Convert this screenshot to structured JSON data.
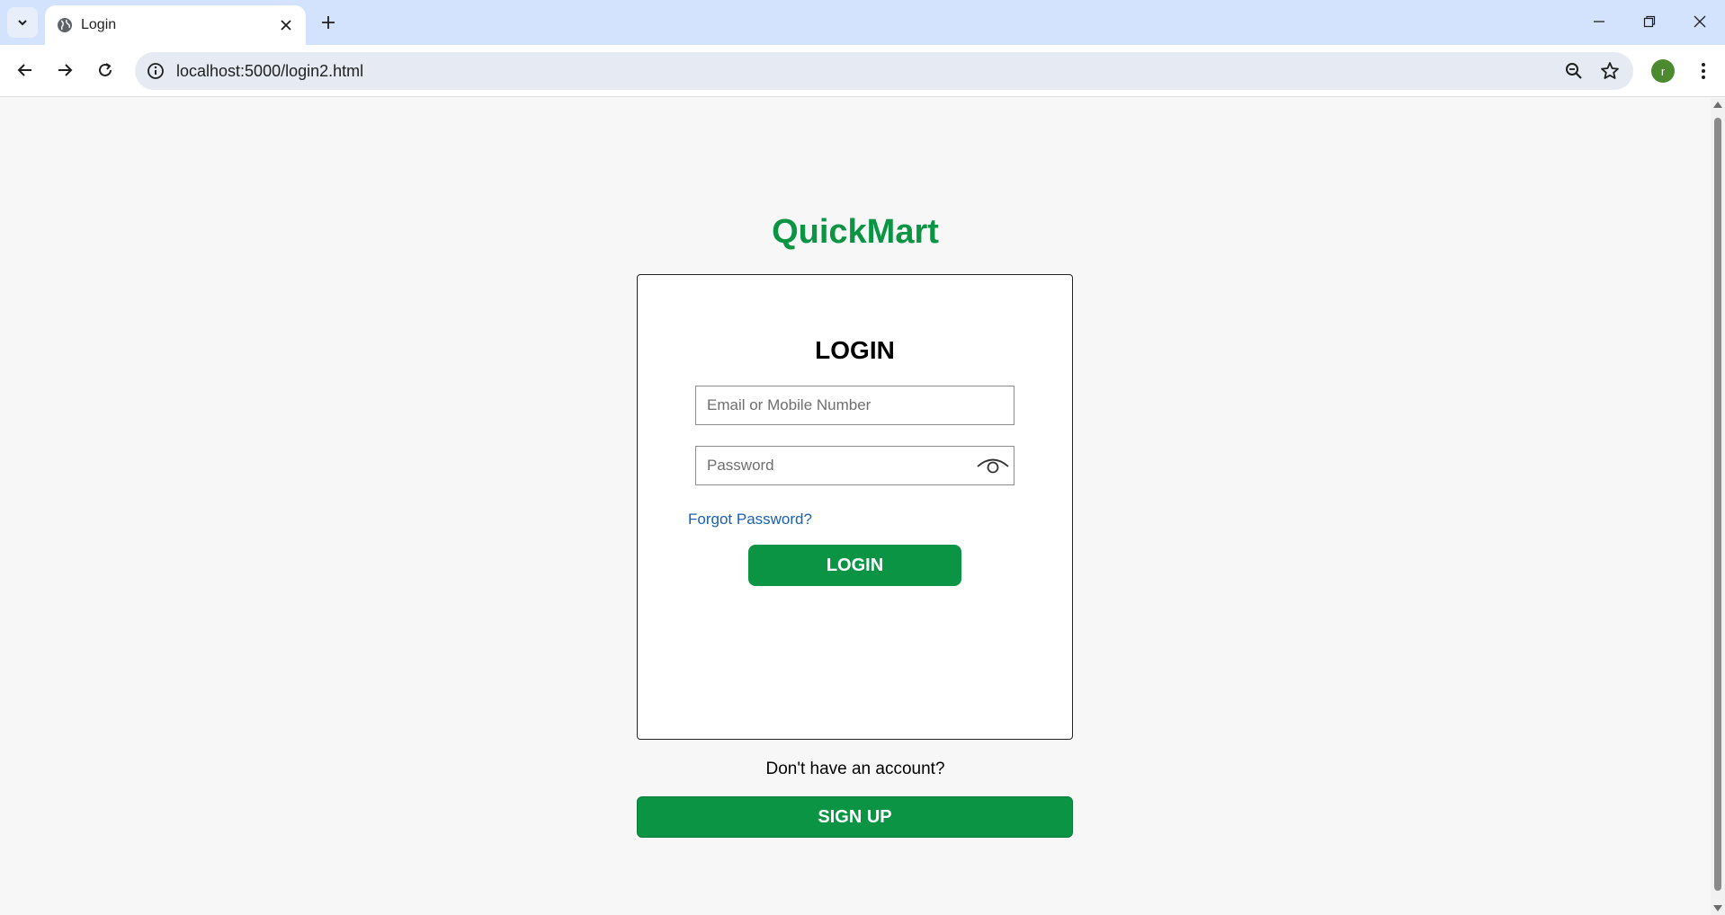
{
  "browser": {
    "tab_title": "Login",
    "url": "localhost:5000/login2.html",
    "profile_initial": "r"
  },
  "page": {
    "brand": "QuickMart",
    "login_heading": "LOGIN",
    "email_placeholder": "Email or Mobile Number",
    "password_placeholder": "Password",
    "forgot_password": "Forgot Password?",
    "login_button": "LOGIN",
    "no_account_text": "Don't have an account?",
    "signup_button": "SIGN UP"
  },
  "colors": {
    "brand_green": "#0a9444",
    "link_blue": "#1a5fb4",
    "tabbar_bg": "#d3e3fd"
  },
  "icons": [
    "tab-list-icon",
    "globe-icon",
    "close-icon",
    "plus-icon",
    "minimize-icon",
    "restore-icon",
    "window-close-icon",
    "back-icon",
    "forward-icon",
    "reload-icon",
    "info-icon",
    "zoom-icon",
    "star-icon",
    "kebab-menu-icon",
    "eye-icon"
  ]
}
